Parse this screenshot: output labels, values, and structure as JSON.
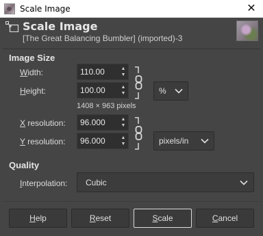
{
  "window": {
    "title": "Scale Image",
    "close_glyph": "✕"
  },
  "header": {
    "title": "Scale Image",
    "subtitle": "[The Great Balancing Bumbler] (imported)-3",
    "icon": "scale-image-icon"
  },
  "image_size": {
    "section_title": "Image Size",
    "width_label_u": "W",
    "width_label_rest": "idth:",
    "width_value": "110.00",
    "height_label_u": "H",
    "height_label_rest": "eight:",
    "height_value": "100.00",
    "unit": "%",
    "pixels_note": "1408 × 963 pixels",
    "chain_linked": true
  },
  "resolution": {
    "x_label_u": "X",
    "x_label_rest": " resolution:",
    "x_value": "96.000",
    "y_label_u": "Y",
    "y_label_rest": " resolution:",
    "y_value": "96.000",
    "unit": "pixels/in",
    "chain_linked": true
  },
  "quality": {
    "section_title": "Quality",
    "interp_label_u": "I",
    "interp_label_rest": "nterpolation:",
    "interpolation": "Cubic"
  },
  "buttons": {
    "help_u": "H",
    "help_rest": "elp",
    "reset_u": "R",
    "reset_rest": "eset",
    "scale_u": "S",
    "scale_rest": "cale",
    "cancel_u": "C",
    "cancel_rest": "ancel"
  },
  "colors": {
    "background": "#454545",
    "field": "#2f2f2f",
    "titlebar": "#ffffff"
  }
}
